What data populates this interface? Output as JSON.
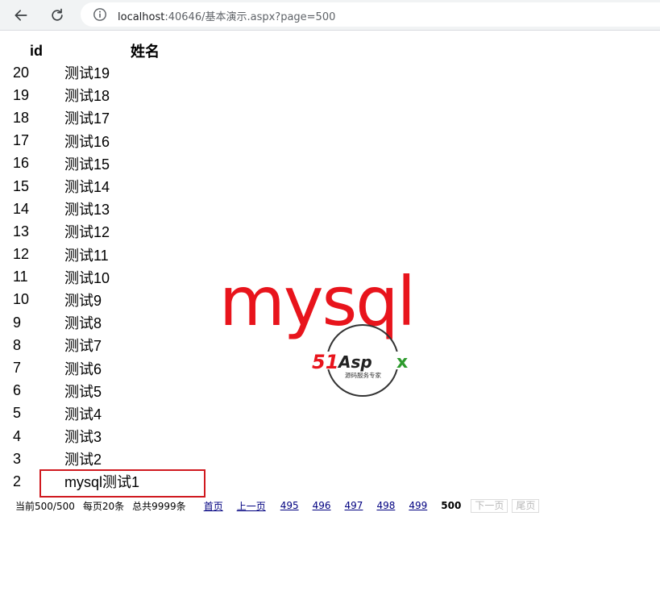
{
  "browser": {
    "url_host": "localhost",
    "url_rest": ":40646/基本演示.aspx?page=500"
  },
  "table": {
    "headers": [
      "id",
      "姓名"
    ],
    "rows": [
      {
        "id": "20",
        "name": "测试19"
      },
      {
        "id": "19",
        "name": "测试18"
      },
      {
        "id": "18",
        "name": "测试17"
      },
      {
        "id": "17",
        "name": "测试16"
      },
      {
        "id": "16",
        "name": "测试15"
      },
      {
        "id": "15",
        "name": "测试14"
      },
      {
        "id": "14",
        "name": "测试13"
      },
      {
        "id": "13",
        "name": "测试12"
      },
      {
        "id": "12",
        "name": "测试11"
      },
      {
        "id": "11",
        "name": "测试10"
      },
      {
        "id": "10",
        "name": "测试9"
      },
      {
        "id": "9",
        "name": "测试8"
      },
      {
        "id": "8",
        "name": "测试7"
      },
      {
        "id": "7",
        "name": "测试6"
      },
      {
        "id": "6",
        "name": "测试5"
      },
      {
        "id": "5",
        "name": "测试4"
      },
      {
        "id": "4",
        "name": "测试3"
      },
      {
        "id": "3",
        "name": "测试2"
      },
      {
        "id": "2",
        "name": "mysql测试1"
      }
    ]
  },
  "pager": {
    "current": "当前500/500",
    "per_page": "每页20条",
    "total": "总共9999条",
    "first": "首页",
    "prev": "上一页",
    "pages": [
      "495",
      "496",
      "497",
      "498",
      "499"
    ],
    "current_page": "500",
    "next": "下一页",
    "last": "尾页"
  },
  "watermark": {
    "text": "mysql",
    "logo_main": "51Aspx",
    "logo_sub": "源码服务专家"
  },
  "colors": {
    "watermark_red": "#e8141c",
    "highlight_border": "#d0191f",
    "link": "#000080",
    "logo_green": "#2d9b2d"
  }
}
